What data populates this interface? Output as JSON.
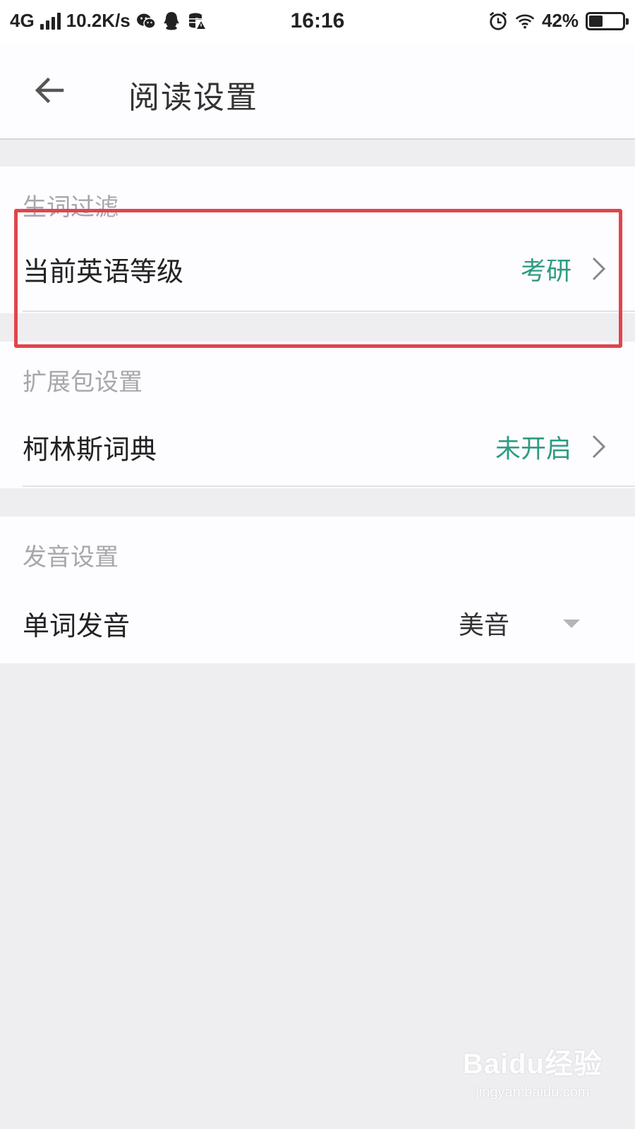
{
  "status_bar": {
    "network": "4G",
    "speed": "10.2K/s",
    "time": "16:16",
    "battery": "42%",
    "battery_level": 0.42,
    "icons": [
      "signal-icon",
      "wechat-icon",
      "qq-icon",
      "storage-icon",
      "alarm-icon",
      "wifi-icon",
      "battery-icon"
    ]
  },
  "app_bar": {
    "title": "阅读设置",
    "back_icon": "back-arrow-icon"
  },
  "sections": [
    {
      "header": "生词过滤",
      "rows": [
        {
          "label": "当前英语等级",
          "value": "考研",
          "control": "chevron-right-icon"
        }
      ]
    },
    {
      "header": "扩展包设置",
      "rows": [
        {
          "label": "柯林斯词典",
          "value": "未开启",
          "control": "chevron-right-icon"
        }
      ]
    },
    {
      "header": "发音设置",
      "rows": [
        {
          "label": "单词发音",
          "value": "美音",
          "control": "dropdown-arrow-icon"
        }
      ]
    }
  ],
  "colors": {
    "accent": "#2e9b82",
    "highlight": "#e0454b",
    "background": "#eeedf0",
    "card": "#fdfcfe",
    "header_text": "#a8a6ab"
  },
  "watermark": {
    "logo": "Baidu经验",
    "url": "jingyan.baidu.com"
  }
}
